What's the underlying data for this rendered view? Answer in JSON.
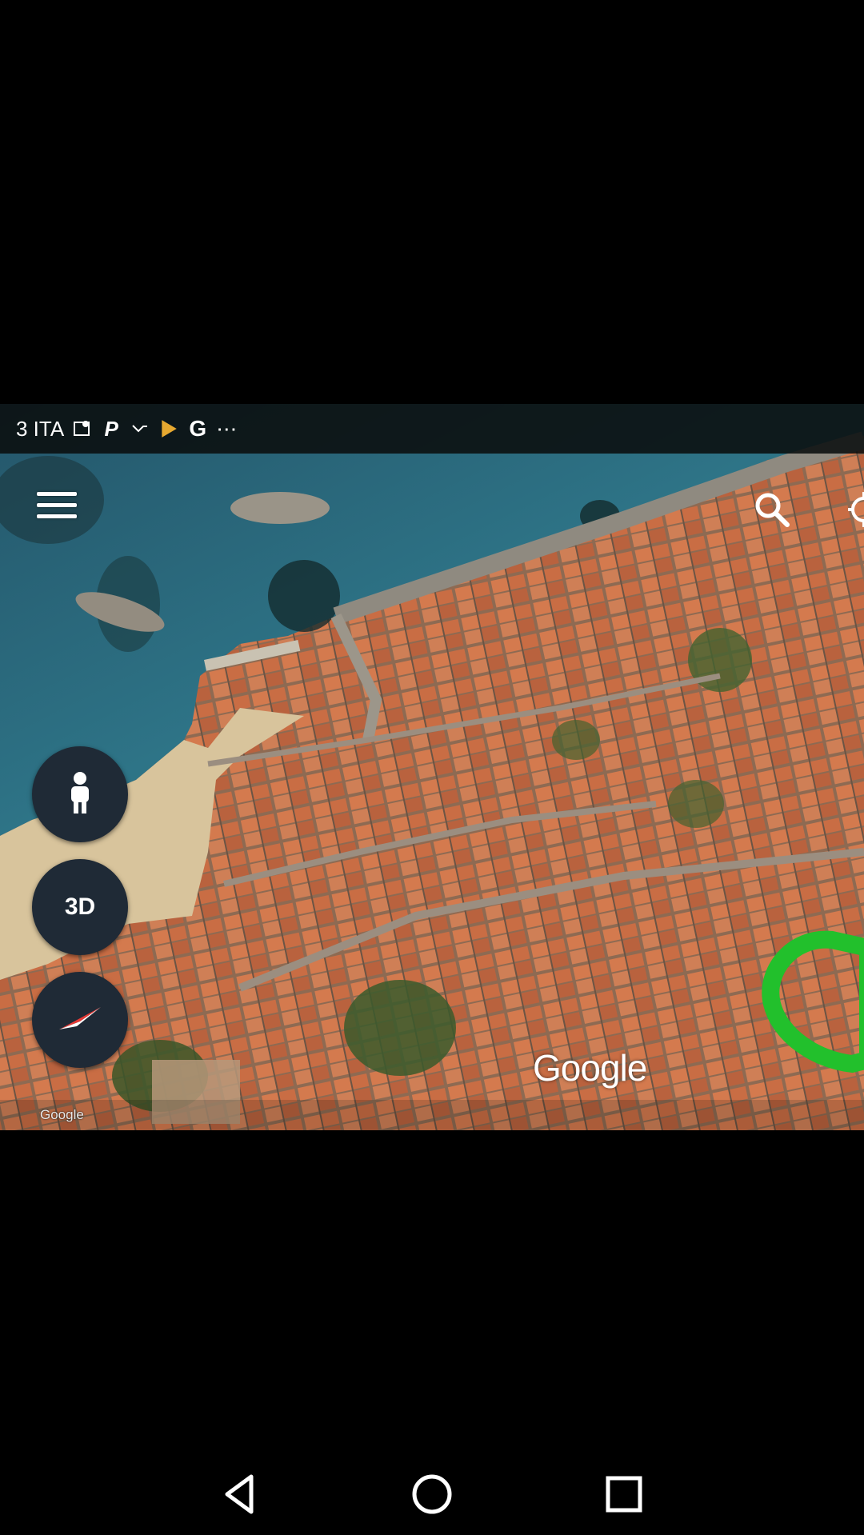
{
  "status_bar": {
    "carrier": "3 ITA",
    "notification_icons": [
      "map-notification-icon",
      "paypal-icon",
      "missed-call-icon",
      "play-store-icon",
      "google-icon"
    ],
    "more": "⋯"
  },
  "map": {
    "type": "satellite",
    "watermark": "Google",
    "attribution": "Google",
    "highlight_color": "#22c02c"
  },
  "controls": {
    "menu_icon": "hamburger-menu-icon",
    "search_icon": "search-icon",
    "location_icon": "my-location-icon",
    "pegman_icon": "pegman-icon",
    "view_mode_label": "3D",
    "compass_icon": "compass-icon"
  },
  "nav_bar": {
    "back": "back-icon",
    "home": "home-icon",
    "recents": "recents-icon"
  }
}
